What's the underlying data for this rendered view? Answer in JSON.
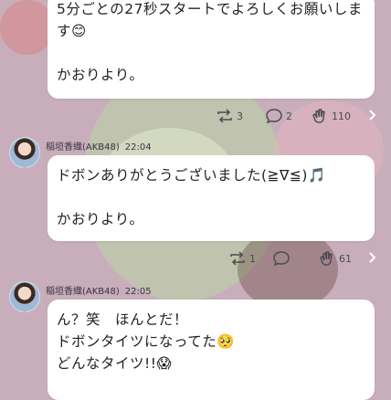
{
  "colors": {
    "background": "#c8aebb",
    "bubble": "#ffffff",
    "text": "#222222"
  },
  "messages": [
    {
      "lines": [
        "5分ごとの27秒スタートでよろしくお願いしま",
        "す😊",
        "",
        "かおりより。"
      ],
      "reactions": {
        "retweets": "3",
        "comments": "2",
        "claps": "110"
      }
    },
    {
      "sender": "稲垣香織(AKB48)",
      "time": "22:04",
      "lines": [
        "ドボンありがとうございました(≧∇≦)🎵",
        "",
        "かおりより。"
      ],
      "reactions": {
        "retweets": "1",
        "comments": "",
        "claps": "61"
      }
    },
    {
      "sender": "稲垣香織(AKB48)",
      "time": "22:05",
      "lines": [
        "ん？笑　ほんとだ！",
        "ドボンタイツになってた🥺",
        "どんなタイツ!!😱"
      ]
    }
  ],
  "icons": [
    "retweet-icon",
    "comment-icon",
    "clap-icon",
    "chevron-right-icon"
  ]
}
